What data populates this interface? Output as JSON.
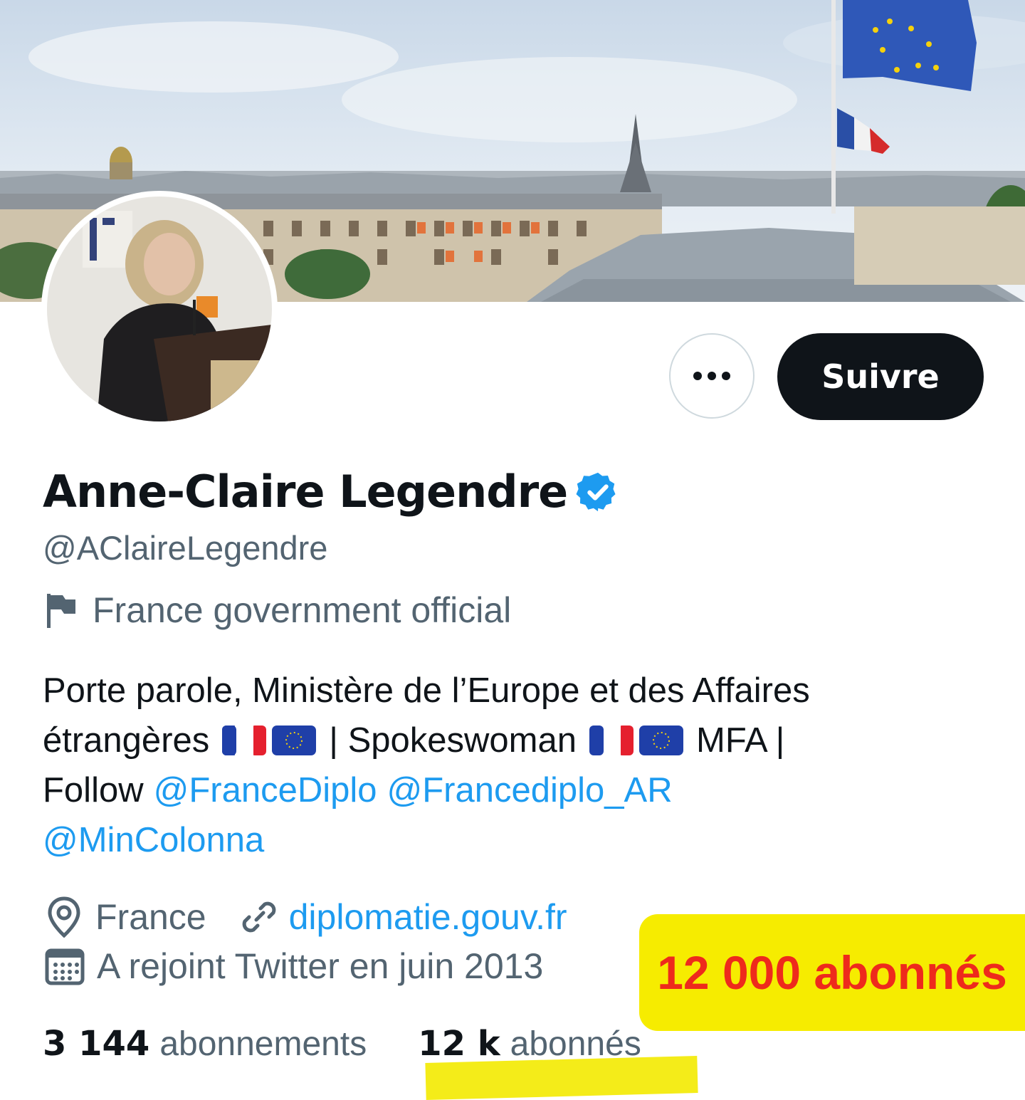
{
  "profile": {
    "display_name": "Anne-Claire Legendre",
    "handle": "@AClaireLegendre",
    "verified_icon": "verified-badge-icon",
    "label_icon": "flag-icon",
    "label": "France government official",
    "bio": {
      "line1": "Porte parole, Ministère de l’Europe et des Affaires",
      "line2_a": "étrangères",
      "line2_b": "| Spokeswoman",
      "line2_c": "MFA |",
      "line3_a": "Follow",
      "mention1": "@FranceDiplo",
      "mention2": "@Francediplo_AR",
      "mention3": "@MinColonna"
    },
    "location_icon": "location-pin-icon",
    "location": "France",
    "link_icon": "link-icon",
    "website": "diplomatie.gouv.fr",
    "calendar_icon": "calendar-icon",
    "joined": "A rejoint Twitter en juin 2013"
  },
  "actions": {
    "more_icon": "more-options-icon",
    "follow_label": "Suivre"
  },
  "stats": {
    "following_count": "3 144",
    "following_label": "abonnements",
    "followers_count": "12 k",
    "followers_label": "abonnés"
  },
  "annotation": {
    "text": "12 000 abonnés"
  },
  "colors": {
    "link_blue": "#1d9bf0",
    "text_primary": "#0f1419",
    "text_secondary": "#536471",
    "highlight_yellow": "#f6ec00",
    "annotation_red": "#ee2a1c",
    "follow_button": "#0f1419"
  }
}
